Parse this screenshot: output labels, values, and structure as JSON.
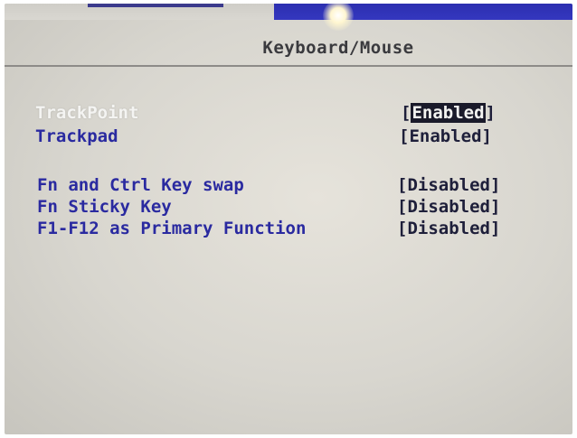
{
  "header": {
    "title": "Keyboard/Mouse"
  },
  "settings": [
    {
      "label": "TrackPoint",
      "value": "Enabled",
      "selected": true
    },
    {
      "label": "Trackpad",
      "value": "Enabled",
      "selected": false
    },
    {
      "label": "Fn and Ctrl Key swap",
      "value": "Disabled",
      "selected": false
    },
    {
      "label": "Fn Sticky Key",
      "value": "Disabled",
      "selected": false
    },
    {
      "label": "F1-F12 as Primary Function",
      "value": "Disabled",
      "selected": false
    }
  ],
  "colors": {
    "label": "#2a2aa0",
    "selected_label": "#f4f4f2",
    "value": "#1e1f3a",
    "highlight_bg": "#1a1a2a",
    "screen_bg": "#dcdad3",
    "top_bar_blue": "#2c2fb0"
  }
}
